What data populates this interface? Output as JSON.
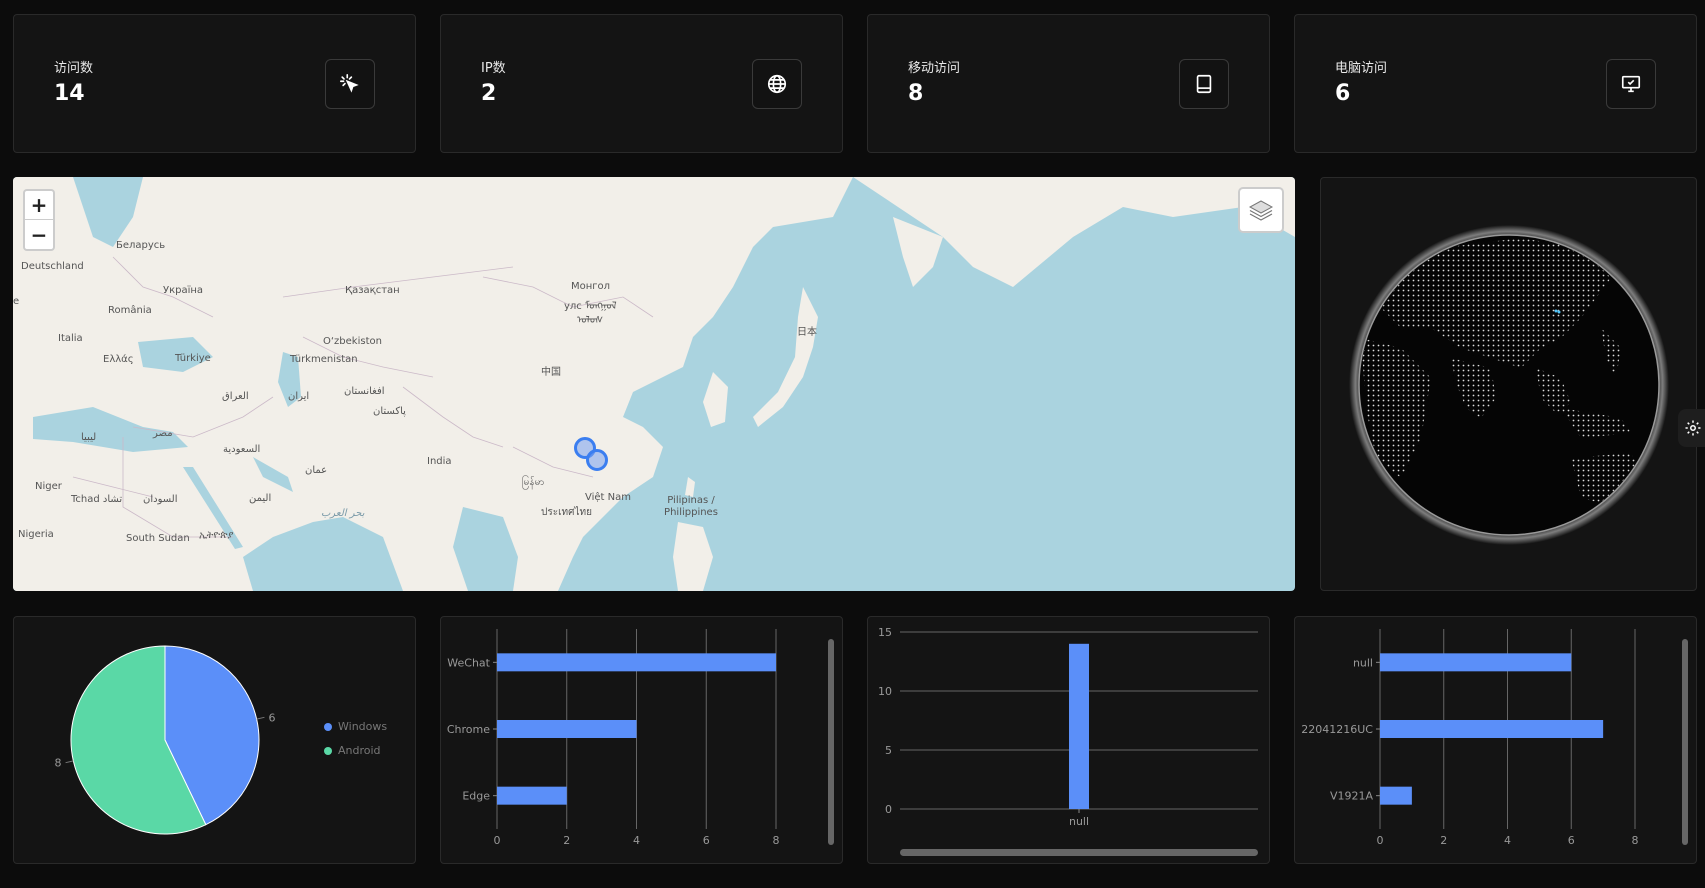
{
  "stats": [
    {
      "label": "访问数",
      "value": "14",
      "icon": "cursor-click-icon"
    },
    {
      "label": "IP数",
      "value": "2",
      "icon": "globe-icon"
    },
    {
      "label": "移动访问",
      "value": "8",
      "icon": "tablet-icon"
    },
    {
      "label": "电脑访问",
      "value": "6",
      "icon": "monitor-icon"
    }
  ],
  "map": {
    "zoom_in": "+",
    "zoom_out": "−",
    "labels": {
      "belarus": "Беларусь",
      "deutschland": "Deutschland",
      "ukraina": "Україна",
      "kazakhstan": "Қазақстан",
      "mongol": "Монгол",
      "mongol2": "улс ᠮᠤᠩᠭᠣᠯ",
      "mongol3": "ᠤᠯᠤᠰ",
      "romania": "România",
      "italia": "Italia",
      "ellas": "Ελλάς",
      "turkiye": "Türkiye",
      "turkmenistan": "Türkmenistan",
      "uzbekiston": "O‘zbekiston",
      "china": "中国",
      "japan": "日本",
      "iraq": "العراق",
      "iran": "ایران",
      "afghanistan": "افغانستان",
      "pakistan": "پاکستان",
      "libya": "ليبيا",
      "misr": "مصر",
      "saudi": "السعودية",
      "india": "India",
      "oman": "عمان",
      "niger": "Niger",
      "tchad": "Tchad تشاد",
      "sudan": "السودان",
      "yemen": "اليمن",
      "arabian_sea": "بحر العرب",
      "myanmar": "မြန်မာ",
      "vietnam": "Việt Nam",
      "thailand": "ประเทศไทย",
      "philippines": "Pilipinas / Philippines",
      "nigeria": "Nigeria",
      "south_sudan": "South Sudan",
      "ethiopia": "ኢትዮጵያ",
      "e": "e"
    }
  },
  "pie_chart": {
    "chart_data": {
      "type": "pie",
      "labels": [
        "Windows",
        "Android"
      ],
      "values": [
        6,
        8
      ],
      "colors": [
        "#5b8ff9",
        "#5ad8a6"
      ]
    },
    "value_labels": [
      "6",
      "8"
    ]
  },
  "browser_chart": {
    "chart_data": {
      "type": "bar",
      "orientation": "horizontal",
      "categories": [
        "WeChat",
        "Chrome",
        "Edge"
      ],
      "values": [
        8,
        4,
        2
      ],
      "xlim": [
        0,
        8
      ],
      "xticks": [
        "0",
        "2",
        "4",
        "6",
        "8"
      ],
      "color": "#5b8ff9"
    }
  },
  "null_chart": {
    "chart_data": {
      "type": "bar",
      "categories": [
        "null"
      ],
      "values": [
        14
      ],
      "ylim": [
        0,
        15
      ],
      "yticks": [
        "0",
        "5",
        "10",
        "15"
      ],
      "color": "#5b8ff9"
    }
  },
  "device_chart": {
    "chart_data": {
      "type": "bar",
      "orientation": "horizontal",
      "categories": [
        "null",
        "22041216UC",
        "V1921A"
      ],
      "values": [
        6,
        7,
        1
      ],
      "xlim": [
        0,
        8
      ],
      "xticks": [
        "0",
        "2",
        "4",
        "6",
        "8"
      ],
      "color": "#5b8ff9"
    }
  }
}
